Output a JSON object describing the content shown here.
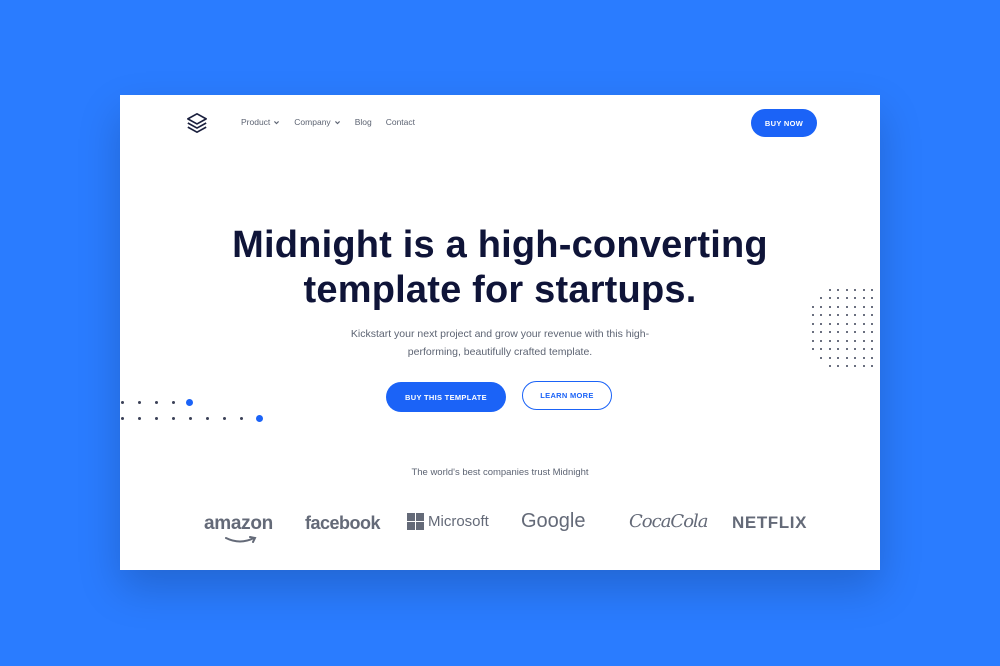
{
  "nav": {
    "logo": "layers-icon",
    "items": [
      {
        "label": "Product",
        "dropdown": true
      },
      {
        "label": "Company",
        "dropdown": true
      },
      {
        "label": "Blog",
        "dropdown": false
      },
      {
        "label": "Contact",
        "dropdown": false
      }
    ],
    "buy_now": "BUY NOW"
  },
  "hero": {
    "title_line1": "Midnight is a high-converting",
    "title_line2": "template for startups.",
    "subtitle": "Kickstart your next project and grow your revenue with this high-performing, beautifully crafted template.",
    "primary_cta": "BUY THIS TEMPLATE",
    "secondary_cta": "LEARN MORE"
  },
  "trust": {
    "text": "The world's best companies trust Midnight",
    "logos": [
      "amazon",
      "facebook",
      "Microsoft",
      "Google",
      "CocaCola",
      "NETFLIX"
    ]
  },
  "colors": {
    "background": "#2a7cff",
    "accent": "#1b63f7",
    "heading": "#0f1438",
    "body_text": "#5d6473",
    "logo_gray": "#646a78"
  }
}
